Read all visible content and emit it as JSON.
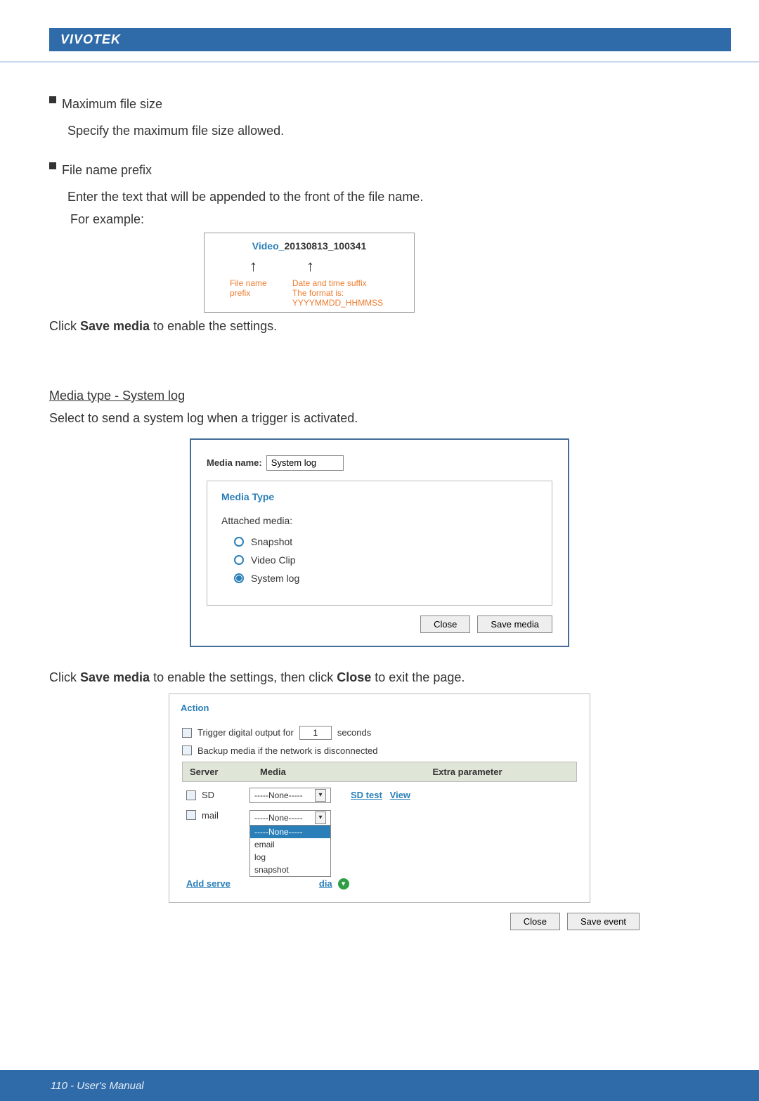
{
  "header": {
    "brand": "VIVOTEK"
  },
  "bullets": {
    "b1_title": "Maximum file size",
    "b1_desc": "Specify the maximum file size allowed.",
    "b2_title": "File name prefix",
    "b2_desc": "Enter the text that will be appended to the front of the file name.",
    "b2_sub": "For example:"
  },
  "example": {
    "prefix_text": "Video",
    "sep": "_",
    "date_text": "20130813_100341",
    "label_prefix": "File name prefix",
    "label_suffix1": "Date and time suffix",
    "label_suffix2": "The format is: YYYYMMDD_HHMMSS"
  },
  "line1a": "Click ",
  "line1b": "Save media",
  "line1c": " to enable the settings.",
  "mt_heading": "Media type - System log",
  "mt_desc": "Select to send a system log when a trigger is activated.",
  "dialog": {
    "media_name_label": "Media name:",
    "media_name_value": "System log",
    "legend": "Media Type",
    "attached": "Attached media:",
    "opt1": "Snapshot",
    "opt2": "Video Clip",
    "opt3": "System log",
    "close": "Close",
    "save": "Save media"
  },
  "line2a": "Click ",
  "line2b": "Save media",
  "line2c": " to enable the settings, then click ",
  "line2d": "Close",
  "line2e": " to exit the page.",
  "action": {
    "legend": "Action",
    "trigger_pre": "Trigger digital output for",
    "trigger_val": "1",
    "trigger_post": "seconds",
    "backup": "Backup media if the network is disconnected",
    "hdr_server": "Server",
    "hdr_media": "Media",
    "hdr_extra": "Extra parameter",
    "r1_label": "SD",
    "r1_media": "-----None-----",
    "r1_sd": "SD test",
    "r1_view": "View",
    "r2_label": "mail",
    "r2_media": "-----None-----",
    "dd_opt_none": "-----None-----",
    "dd_opt_email": "email",
    "dd_opt_log": "log",
    "dd_opt_snap": "snapshot",
    "add_server": "Add serve",
    "add_media_frag": "dia",
    "close": "Close",
    "save": "Save event"
  },
  "footer": {
    "text": "110 - User's Manual"
  }
}
